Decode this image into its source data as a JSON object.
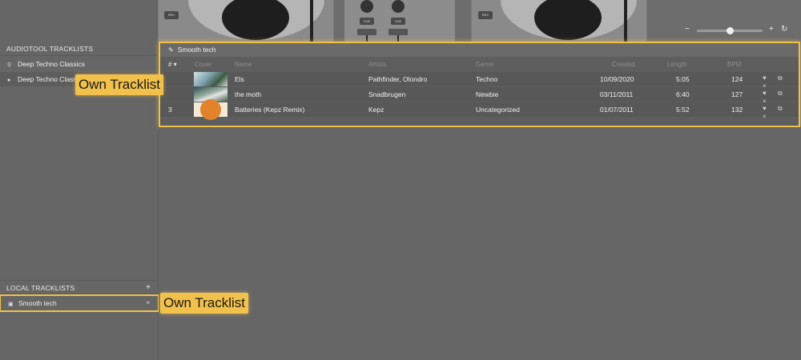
{
  "deck": {
    "rev_label": "REV",
    "cue_label": "CUE",
    "zoom_minus": "−",
    "zoom_plus": "+",
    "zoom_reset": "↻",
    "zoom_level": 0.5
  },
  "sidebar": {
    "audiotool_header": "AUDIOTOOL TRACKLISTS",
    "search_item": "Deep Techno Classics",
    "selected_item": "Deep Techno Classics",
    "local_header": "LOCAL TRACKLISTS",
    "local_add": "+",
    "local_items": [
      {
        "label": "Smooth tech",
        "close": "×"
      }
    ]
  },
  "tracklist": {
    "title": "Smooth tech",
    "columns": {
      "num": "# ▾",
      "cover": "Cover",
      "name": "Name",
      "artists": "Artists",
      "genre": "Genre",
      "created": "Created",
      "length": "Length",
      "bpm": "BPM"
    },
    "rows": [
      {
        "num": "",
        "name": "Els",
        "artists": "Pathfinder, Olondro",
        "genre": "Techno",
        "created": "10/09/2020",
        "length": "5:05",
        "bpm": "124",
        "actions": "♥ ⧉ ×"
      },
      {
        "num": "",
        "name": "the moth",
        "artists": "Snadbrugen",
        "genre": "Newbie",
        "created": "03/11/2011",
        "length": "6:40",
        "bpm": "127",
        "actions": "♥ ⧉ ×"
      },
      {
        "num": "3",
        "name": "Batteries (Kepz Remix)",
        "artists": "Kepz",
        "genre": "Uncategorized",
        "created": "01/07/2011",
        "length": "5:52",
        "bpm": "132",
        "actions": "♥ ⧉ ×"
      }
    ]
  },
  "callouts": {
    "top": "Own Tracklist",
    "bottom": "Own Tracklist"
  },
  "colors": {
    "highlight": "#f0c14a",
    "background": "#666666"
  }
}
